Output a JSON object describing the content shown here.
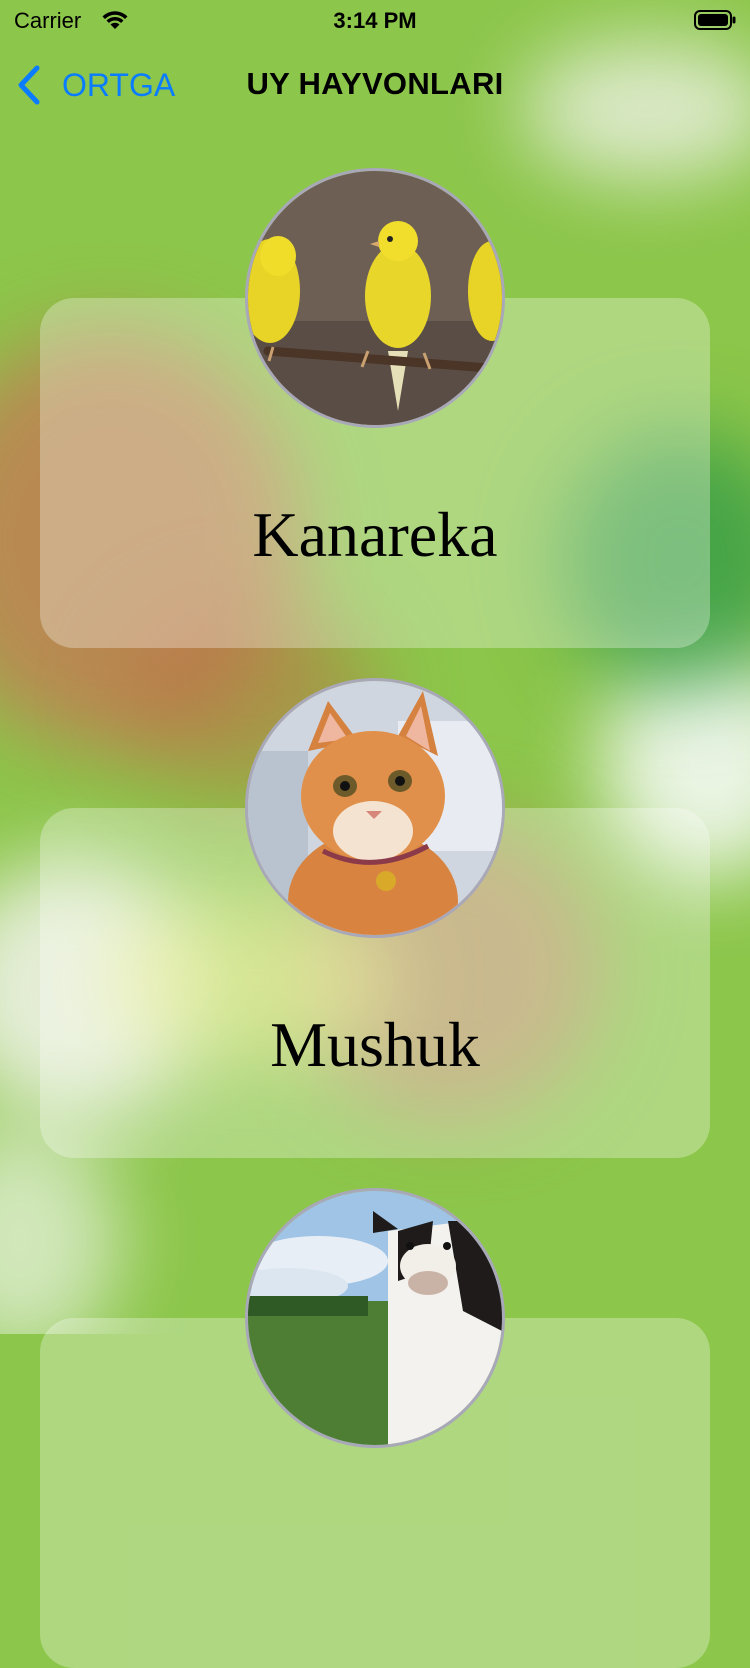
{
  "status": {
    "carrier": "Carrier",
    "time": "3:14 PM"
  },
  "nav": {
    "back_label": "ORTGA",
    "title": "UY HAYVONLARI"
  },
  "animals": [
    {
      "name": "Kanareka",
      "icon": "canary-photo"
    },
    {
      "name": "Mushuk",
      "icon": "cat-photo"
    },
    {
      "name": "",
      "icon": "cow-photo"
    }
  ],
  "colors": {
    "accent": "#0a7cff",
    "background": "#8cc64a"
  }
}
